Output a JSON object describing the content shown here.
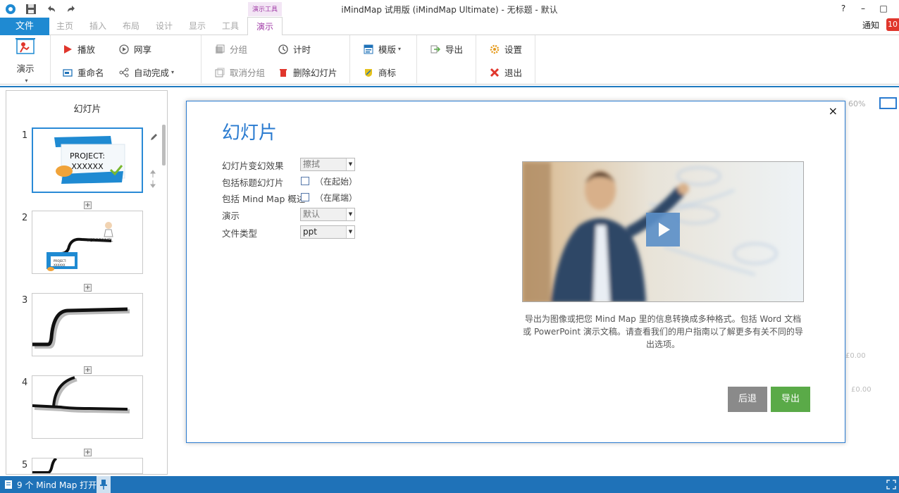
{
  "titlebar": {
    "title": "iMindMap 试用版 (iMindMap Ultimate) - 无标题 - 默认",
    "context_tab": "演示工具",
    "help": "?",
    "minimize": "–",
    "maximize": "□"
  },
  "tabs": {
    "file": "文件",
    "items": [
      "主页",
      "插入",
      "布局",
      "设计",
      "显示",
      "工具"
    ],
    "active": "演示",
    "notify_label": "通知",
    "notify_count": "10"
  },
  "ribbon": {
    "present": "演示",
    "play": "播放",
    "share": "网享",
    "rename": "重命名",
    "autocomplete": "自动完成",
    "group": "分组",
    "timer": "计时",
    "ungroup": "取消分组",
    "delete_slide": "删除幻灯片",
    "template": "模版",
    "brand": "商标",
    "export": "导出",
    "settings": "设置",
    "exit": "退出"
  },
  "left_panel": {
    "title": "幻灯片",
    "slides": [
      {
        "number": "1",
        "line1": "PROJECT:",
        "line2": "XXXXXX"
      },
      {
        "number": "2",
        "label": "PERSONNEL",
        "mini1": "PROJECT:",
        "mini2": "XXXXXX"
      },
      {
        "number": "3"
      },
      {
        "number": "4"
      },
      {
        "number": "5"
      }
    ]
  },
  "canvas": {
    "zoom": "60%",
    "value1": "£0.00",
    "value2": "£0.00"
  },
  "dialog": {
    "title": "幻灯片",
    "transition_label": "幻灯片变幻效果",
    "transition_value": "擦拭",
    "title_slide_label": "包括标题幻灯片",
    "title_slide_note": "（在起始）",
    "overview_label": "包括 Mind Map 概述",
    "overview_note": "（在尾端）",
    "present_label": "演示",
    "present_value": "默认",
    "filetype_label": "文件类型",
    "filetype_value": "ppt",
    "description": "导出为图像或把您 Mind Map 里的信息转换成多种格式。包括 Word 文档或 PowerPoint 演示文稿。请查看我们的用户指南以了解更多有关不同的导出选项。",
    "back": "后退",
    "export": "导出",
    "close": "×"
  },
  "statusbar": {
    "text": "9 个 Mind Map 打开"
  },
  "colors": {
    "accent": "#1f8ad2",
    "context": "#a23ea8",
    "export_btn": "#5aaa48",
    "back_btn": "#8a8a8a",
    "statusbar": "#1f72b8"
  }
}
